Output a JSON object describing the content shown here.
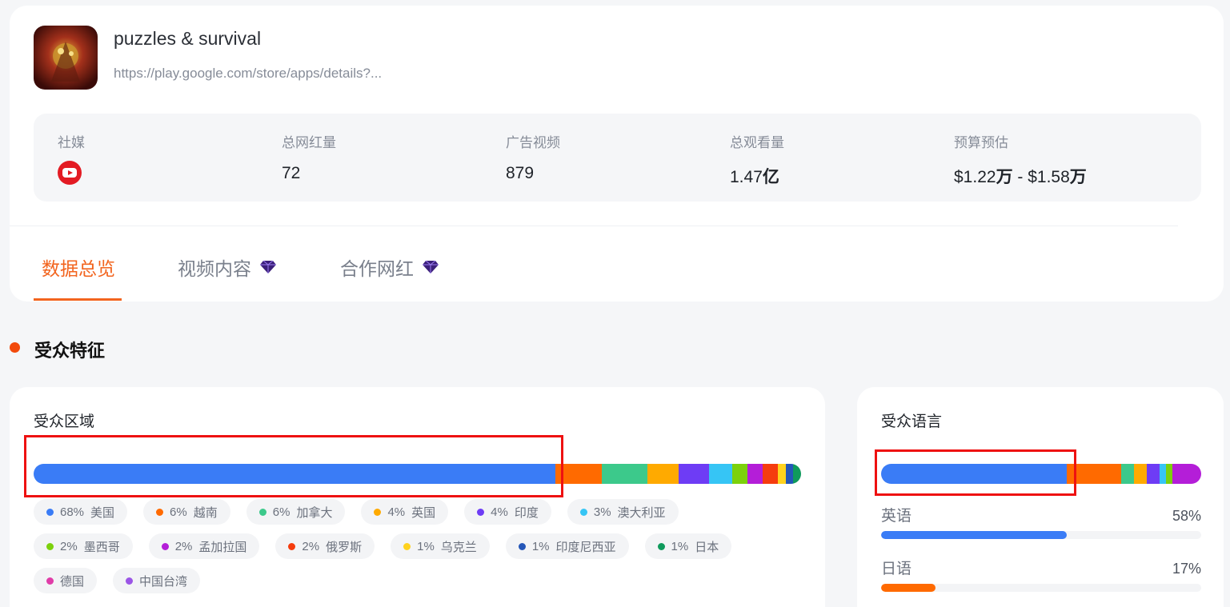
{
  "app": {
    "name": "puzzles & survival",
    "url": "https://play.google.com/store/apps/details?..."
  },
  "stats": {
    "social_label": "社媒",
    "social_icon": "youtube-icon",
    "influencers_label": "总网红量",
    "influencers_value": "72",
    "ad_videos_label": "广告视频",
    "ad_videos_value": "879",
    "views_label": "总观看量",
    "views_value": "1.47",
    "views_unit": "亿",
    "budget_label": "预算预估",
    "budget_low": "$1.22",
    "budget_low_unit": "万",
    "budget_sep": " - ",
    "budget_high": "$1.58",
    "budget_high_unit": "万"
  },
  "tabs": [
    {
      "label": "数据总览",
      "active": true,
      "premium": false
    },
    {
      "label": "视频内容",
      "active": false,
      "premium": true
    },
    {
      "label": "合作网红",
      "active": false,
      "premium": true
    }
  ],
  "section_title": "受众特征",
  "region": {
    "title": "受众区域",
    "segments": [
      {
        "pct": "68%",
        "name": "美国",
        "color": "#3a7cf6",
        "share": 68
      },
      {
        "pct": "6%",
        "name": "越南",
        "color": "#ff6a00",
        "share": 6
      },
      {
        "pct": "6%",
        "name": "加拿大",
        "color": "#3cc98b",
        "share": 6
      },
      {
        "pct": "4%",
        "name": "英国",
        "color": "#ffaa00",
        "share": 4
      },
      {
        "pct": "4%",
        "name": "印度",
        "color": "#6e3cf5",
        "share": 4
      },
      {
        "pct": "3%",
        "name": "澳大利亚",
        "color": "#36c5f5",
        "share": 3
      },
      {
        "pct": "2%",
        "name": "墨西哥",
        "color": "#7cd10c",
        "share": 2
      },
      {
        "pct": "2%",
        "name": "孟加拉国",
        "color": "#b41ed8",
        "share": 2
      },
      {
        "pct": "2%",
        "name": "俄罗斯",
        "color": "#f53c0e",
        "share": 2
      },
      {
        "pct": "1%",
        "name": "乌克兰",
        "color": "#ffd21e",
        "share": 1
      },
      {
        "pct": "1%",
        "name": "印度尼西亚",
        "color": "#2456b8",
        "share": 1
      },
      {
        "pct": "1%",
        "name": "日本",
        "color": "#0f9a5c",
        "share": 1
      },
      {
        "pct": "",
        "name": "德国",
        "color": "#e03ca8",
        "share": 0
      },
      {
        "pct": "",
        "name": "中国台湾",
        "color": "#9b55e6",
        "share": 0
      }
    ]
  },
  "language": {
    "title": "受众语言",
    "bar": [
      {
        "color": "#3a7cf6",
        "share": 58
      },
      {
        "color": "#ff6a00",
        "share": 17
      },
      {
        "color": "#3cc98b",
        "share": 4
      },
      {
        "color": "#ffaa00",
        "share": 4
      },
      {
        "color": "#6e3cf5",
        "share": 4
      },
      {
        "color": "#36c5f5",
        "share": 2
      },
      {
        "color": "#7cd10c",
        "share": 2
      },
      {
        "color": "#b41ed8",
        "share": 9
      }
    ],
    "items": [
      {
        "name": "英语",
        "pct": "58%",
        "color": "#3a7cf6",
        "share": 58
      },
      {
        "name": "日语",
        "pct": "17%",
        "color": "#ff6a00",
        "share": 17
      }
    ]
  }
}
